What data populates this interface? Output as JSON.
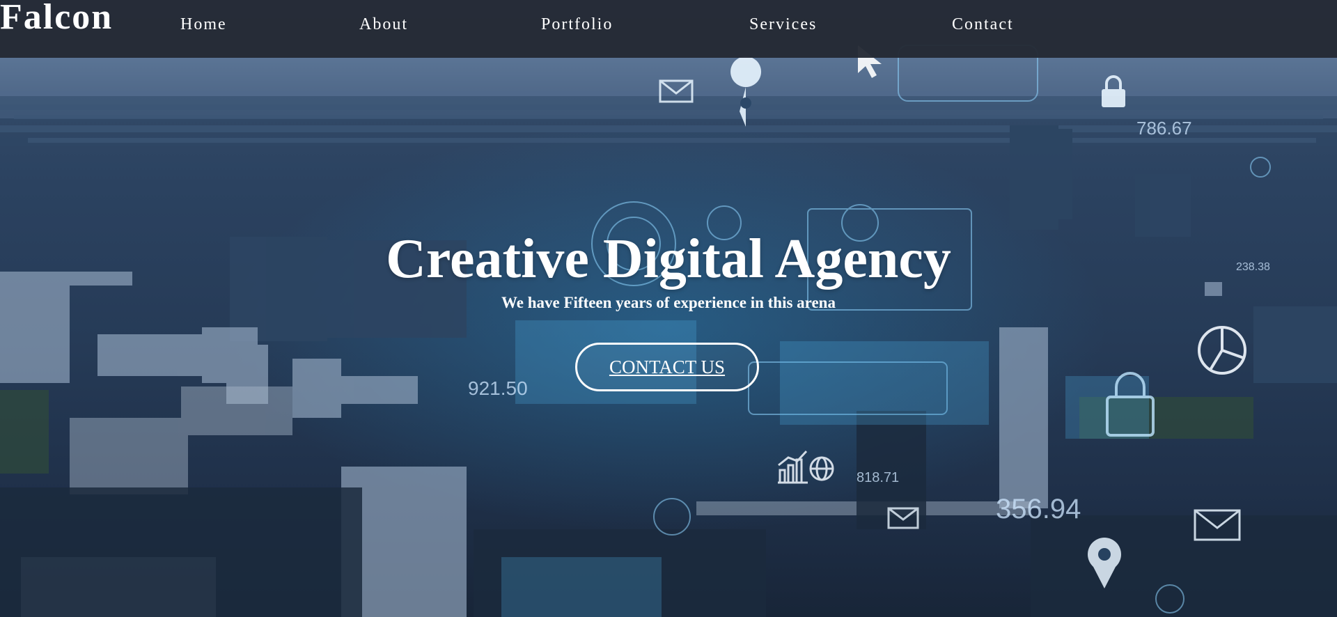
{
  "brand": {
    "name": "Falcon"
  },
  "nav": {
    "items": [
      {
        "label": "Home"
      },
      {
        "label": "About"
      },
      {
        "label": "Portfolio"
      },
      {
        "label": "Services"
      },
      {
        "label": "Contact"
      }
    ]
  },
  "hero": {
    "title": "Creative Digital Agency",
    "subtitle": "We have Fifteen years of experience in this arena",
    "cta_label": "CONTACT US",
    "background_overlay_numbers": [
      "786.67",
      "921.50",
      "356.94",
      "818.71",
      "238.38"
    ]
  },
  "colors": {
    "navbar_bg": "#242a34",
    "text": "#ffffff",
    "hero_tint": "#2b4260",
    "accent_glow": "#3aa8e0"
  },
  "icons": [
    "mail-icon",
    "location-pin-icon",
    "lock-icon",
    "pie-chart-icon",
    "chart-icon",
    "globe-icon",
    "cursor-icon"
  ]
}
